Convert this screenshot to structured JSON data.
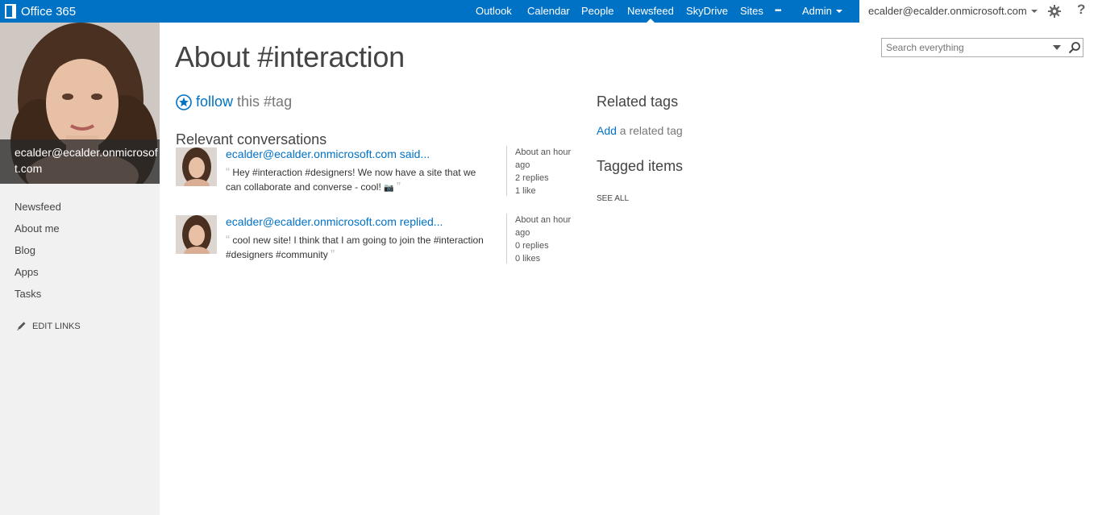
{
  "suite": {
    "brand": "Office 365",
    "nav": [
      "Outlook",
      "Calendar",
      "People",
      "Newsfeed",
      "SkyDrive",
      "Sites",
      "•••",
      "Admin"
    ],
    "selected": "Newsfeed",
    "user_email": "ecalder@ecalder.onmicrosoft.com",
    "help": "?"
  },
  "profile": {
    "name": "ecalder@ecalder.onmicrosoft.com"
  },
  "leftnav": {
    "items": [
      "Newsfeed",
      "About me",
      "Blog",
      "Apps",
      "Tasks"
    ],
    "edit_links": "EDIT LINKS"
  },
  "page": {
    "title": "About #interaction",
    "follow_word": "follow",
    "follow_rest": "this #tag",
    "relevant_heading": "Relevant conversations",
    "related_heading": "Related tags",
    "add_word": "Add",
    "add_rest": " a related tag",
    "tagged_heading": "Tagged items",
    "see_all": "SEE ALL"
  },
  "search": {
    "placeholder": "Search everything"
  },
  "conversations": [
    {
      "author": "ecalder@ecalder.onmicrosoft.com",
      "verb": "said...",
      "text": "Hey #interaction #designers! We now have a site that we can collaborate and converse - cool!",
      "time": "About an hour ago",
      "replies": "2 replies",
      "likes": "1 like"
    },
    {
      "author": "ecalder@ecalder.onmicrosoft.com",
      "verb": "replied...",
      "text": "cool new site! I think that I am going to join the #interaction #designers #community",
      "time": "About an hour ago",
      "replies": "0 replies",
      "likes": "0 likes"
    }
  ],
  "colors": {
    "suitebar": "#0072c6",
    "link": "#0072c6",
    "rail": "#f1f1f1"
  }
}
